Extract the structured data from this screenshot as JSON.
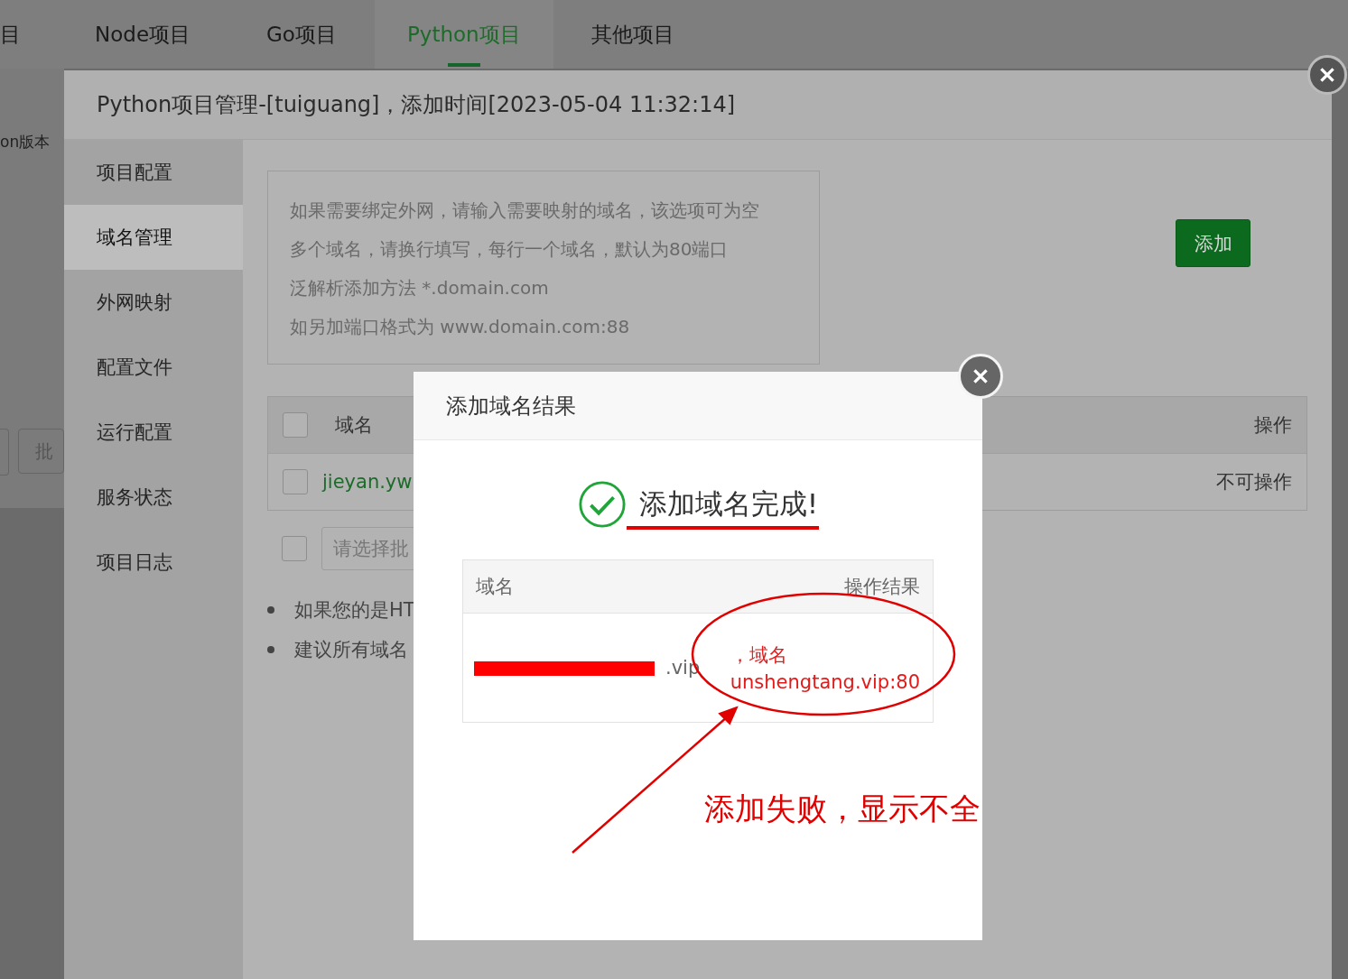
{
  "top_tabs": [
    {
      "label": "目",
      "selected": false
    },
    {
      "label": "Node项目",
      "selected": false
    },
    {
      "label": "Go项目",
      "selected": false
    },
    {
      "label": "Python项目",
      "selected": true
    },
    {
      "label": "其他项目",
      "selected": false
    }
  ],
  "background_page": {
    "column_label": "on版本",
    "button_label": "批"
  },
  "project_modal": {
    "title": "Python项目管理-[tuiguang]，添加时间[2023-05-04 11:32:14]",
    "sidebar": [
      {
        "label": "项目配置",
        "selected": false
      },
      {
        "label": "域名管理",
        "selected": true
      },
      {
        "label": "外网映射",
        "selected": false
      },
      {
        "label": "配置文件",
        "selected": false
      },
      {
        "label": "运行配置",
        "selected": false
      },
      {
        "label": "服务状态",
        "selected": false
      },
      {
        "label": "项目日志",
        "selected": false
      }
    ],
    "domain_input": {
      "placeholder": [
        "如果需要绑定外网，请输入需要映射的域名，该选项可为空",
        "多个域名，请换行填写，每行一个域名，默认为80端口",
        "泛解析添加方法 *.domain.com",
        "如另加端口格式为 www.domain.com:88"
      ]
    },
    "add_button": "添加",
    "table": {
      "columns": [
        "域名",
        "操作"
      ],
      "rows": [
        {
          "domain": "jieyan.yw",
          "action": "不可操作",
          "checked": false
        }
      ],
      "all_checked": false
    },
    "batch": {
      "checked": false,
      "placeholder": "请选择批"
    },
    "notes": [
      "如果您的是HT",
      "建议所有域名"
    ]
  },
  "result_dialog": {
    "title": "添加域名结果",
    "message": "添加域名完成!",
    "table": {
      "columns": [
        "域名",
        "操作结果"
      ],
      "rows": [
        {
          "domain": ".vip",
          "result": [
            "，域名",
            "unshengtang.vip:80"
          ]
        }
      ]
    }
  },
  "annotation": {
    "text": "添加失败，显示不全"
  }
}
